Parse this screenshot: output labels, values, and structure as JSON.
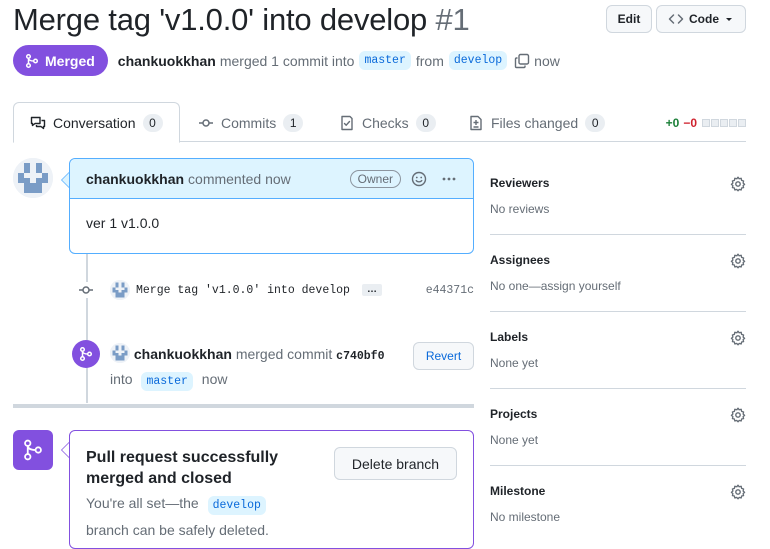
{
  "header": {
    "title": "Merge tag 'v1.0.0' into develop",
    "number": "#1",
    "edit_label": "Edit",
    "code_label": "Code"
  },
  "meta": {
    "state": "Merged",
    "author": "chankuokkhan",
    "action_text": "merged 1 commit into",
    "base_branch": "master",
    "from_text": "from",
    "head_branch": "develop",
    "time": "now"
  },
  "tabs": [
    {
      "label": "Conversation",
      "count": "0",
      "icon": "comment-discussion-icon"
    },
    {
      "label": "Commits",
      "count": "1",
      "icon": "git-commit-icon"
    },
    {
      "label": "Checks",
      "count": "0",
      "icon": "checklist-icon"
    },
    {
      "label": "Files changed",
      "count": "0",
      "icon": "file-diff-icon"
    }
  ],
  "diffstat": {
    "additions": "+0",
    "deletions": "−0"
  },
  "comment": {
    "author": "chankuokkhan",
    "action": "commented now",
    "role": "Owner",
    "body": "ver 1 v1.0.0"
  },
  "commit": {
    "message": "Merge tag 'v1.0.0' into develop",
    "ellipsis": "…",
    "sha": "e44371c"
  },
  "merge_event": {
    "author": "chankuokkhan",
    "action": "merged commit",
    "sha": "c740bf0",
    "into_text": "into",
    "branch": "master",
    "time": "now",
    "revert_label": "Revert"
  },
  "merged_box": {
    "title": "Pull request successfully merged and closed",
    "desc_prefix": "You're all set—the",
    "branch": "develop",
    "desc_suffix": "branch can be safely deleted.",
    "delete_label": "Delete branch"
  },
  "sidebar": [
    {
      "title": "Reviewers",
      "value": "No reviews"
    },
    {
      "title": "Assignees",
      "value": "No one—assign yourself"
    },
    {
      "title": "Labels",
      "value": "None yet"
    },
    {
      "title": "Projects",
      "value": "None yet"
    },
    {
      "title": "Milestone",
      "value": "No milestone"
    }
  ],
  "colors": {
    "merged_purple": "#8250df",
    "link_blue": "#0969da",
    "border": "#d0d7de",
    "comment_header_bg": "#ddf4ff"
  }
}
